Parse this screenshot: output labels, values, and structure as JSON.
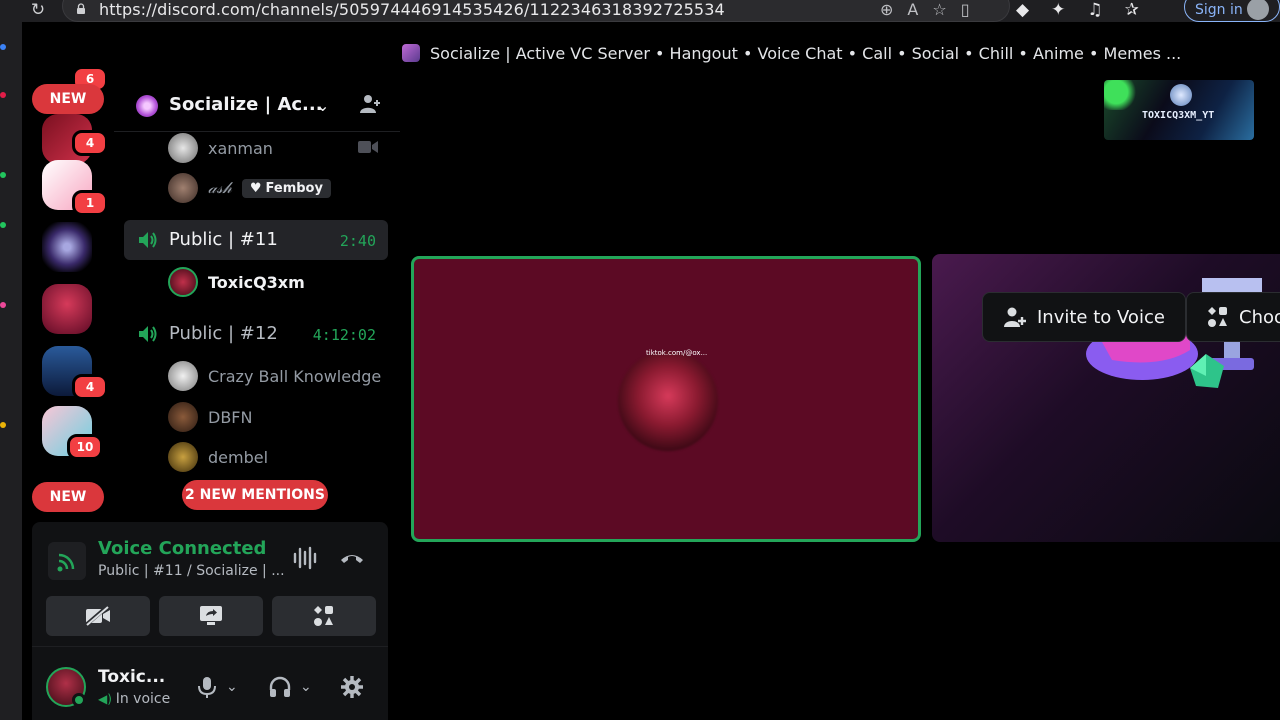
{
  "browser": {
    "url": "https://discord.com/channels/505974446914535426/1122346318392725534",
    "signin_label": "Sign in"
  },
  "title_bar": {
    "title": "Socialize | Active VC Server • Hangout • Voice Chat • Call • Social • Chill • Anime • Memes ..."
  },
  "servers": {
    "new_top": "NEW",
    "new_bottom": "NEW",
    "badges": [
      "6",
      "4",
      "1",
      "4",
      "10"
    ]
  },
  "sidebar": {
    "server_name": "Socialize | Ac...",
    "users_above": [
      {
        "name": "xanman"
      },
      {
        "name": "𝒶𝓈𝒽",
        "tag": "Femboy"
      }
    ],
    "channels": [
      {
        "name": "Public | #11",
        "time": "2:40",
        "users": [
          "ToxicQ3xm"
        ]
      },
      {
        "name": "Public | #12",
        "time": "4:12:02",
        "users": [
          "Crazy Ball Knowledge",
          "DBFN",
          "dembel"
        ]
      }
    ],
    "mentions_pill": "2 NEW MENTIONS"
  },
  "voice_panel": {
    "status": "Voice Connected",
    "location": "Public | #11 / Socialize | ..."
  },
  "user_panel": {
    "name": "Toxic...",
    "status": "In voice"
  },
  "stage": {
    "streamer_label": "TOXICQ3XM_YT",
    "tile_avatar_text": "tiktok.com/@ox...",
    "invite_label": "Invite to Voice",
    "choose_label": "Choo"
  },
  "colors": {
    "accent_green": "#23a559",
    "tile_bg": "#5c0a24",
    "danger": "#da373c"
  }
}
